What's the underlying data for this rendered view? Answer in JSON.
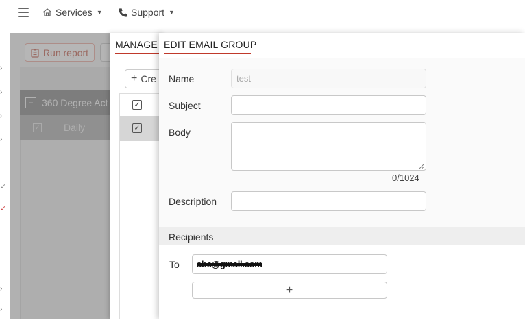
{
  "topbar": {
    "services_label": "Services",
    "support_label": "Support"
  },
  "background": {
    "run_report_label": "Run report",
    "group_row_label": "360 Degree Act",
    "daily_row_label": "Daily"
  },
  "manage_panel": {
    "title": "MANAGE E",
    "create_label": "Cre"
  },
  "edit_panel": {
    "title": "EDIT EMAIL GROUP",
    "name_label": "Name",
    "name_value": "test",
    "subject_label": "Subject",
    "subject_value": "",
    "body_label": "Body",
    "body_value": "",
    "char_counter": "0/1024",
    "description_label": "Description",
    "description_value": "",
    "recipients_label": "Recipients",
    "to_label": "To",
    "to_value": "abc@gmail.com",
    "add_recipient_symbol": "+"
  },
  "colors": {
    "accent": "#c0392b",
    "run_report_border": "#e7b3ab"
  }
}
